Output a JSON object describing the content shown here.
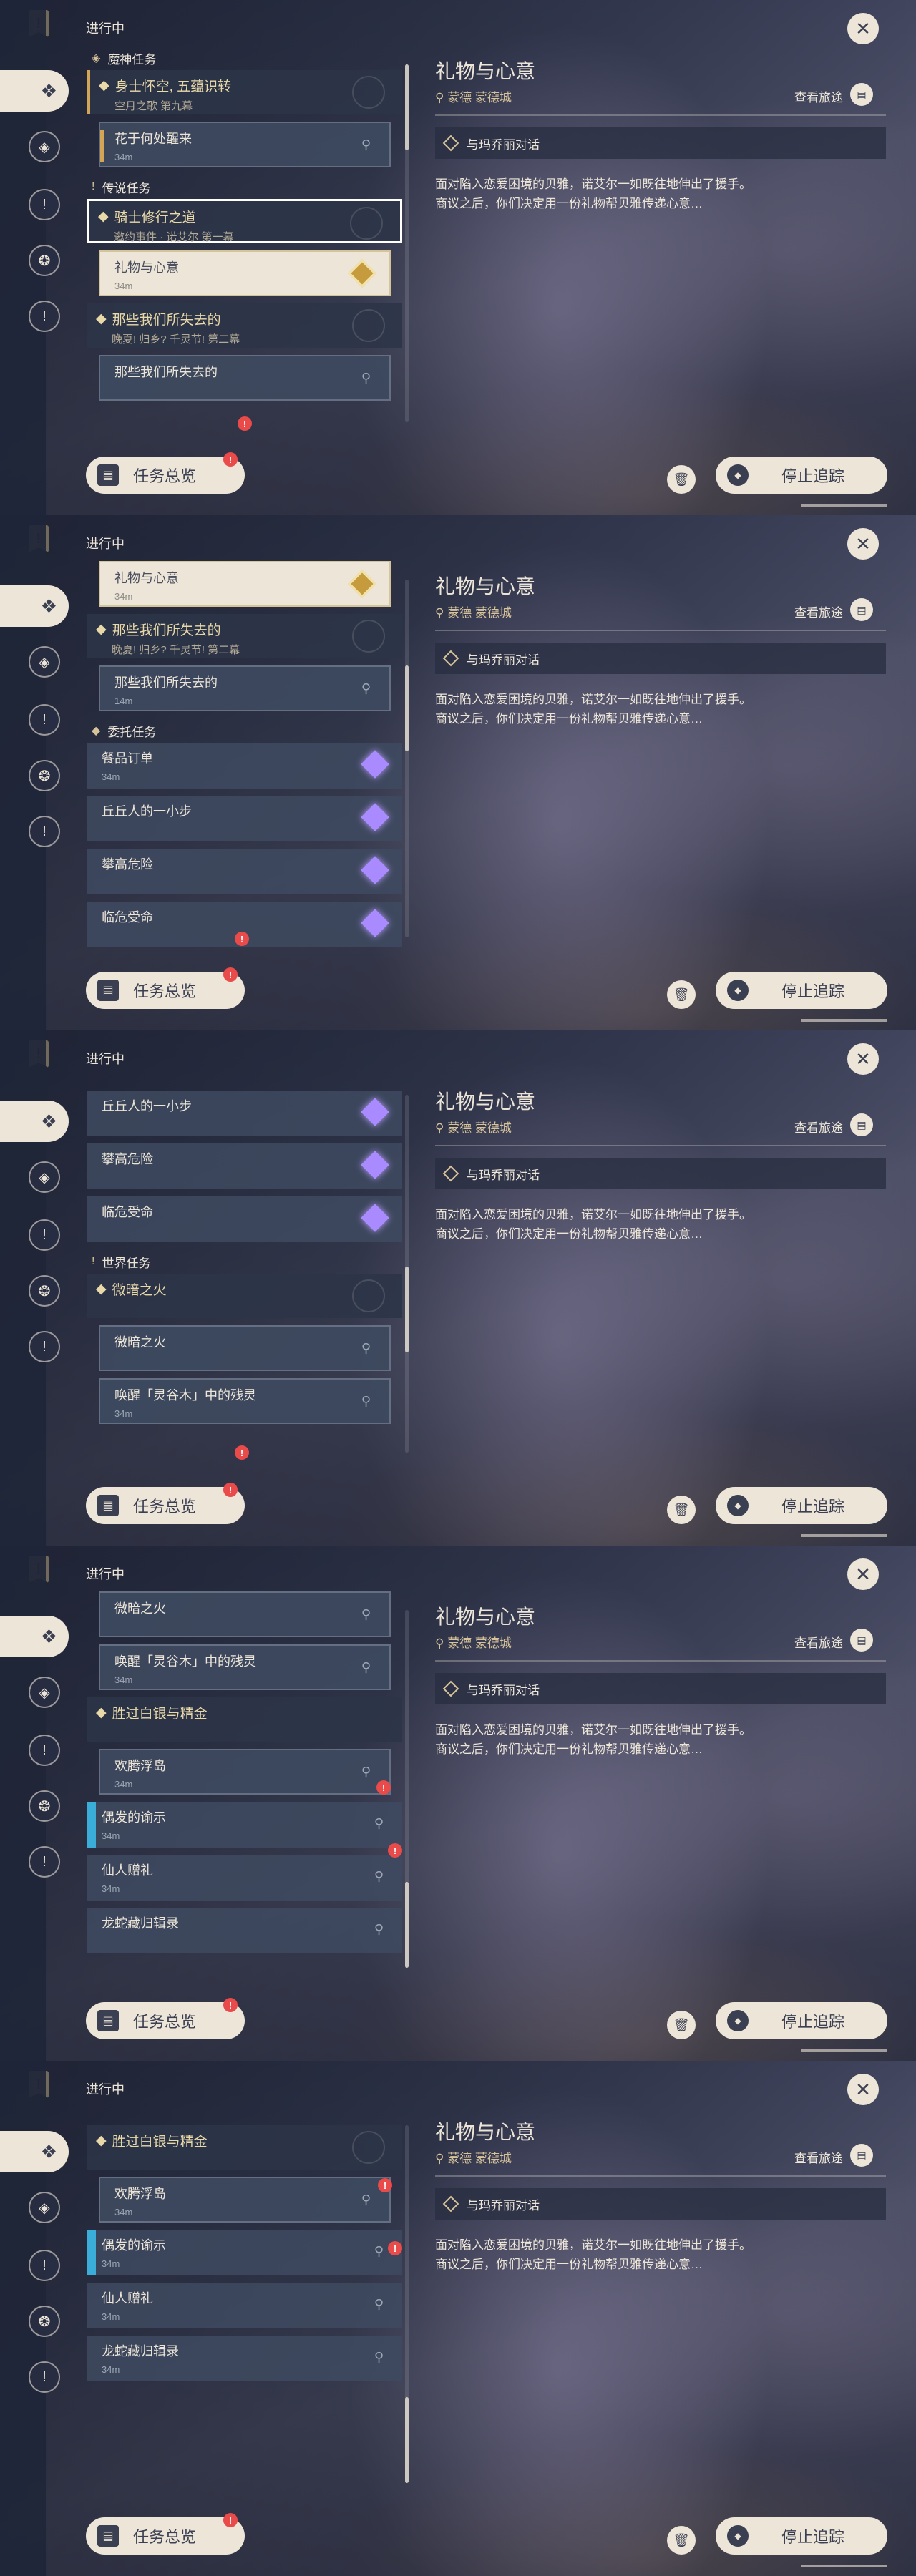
{
  "header": {
    "in_progress": "进行中"
  },
  "buttons": {
    "overview": "任务总览",
    "stop": "停止追踪",
    "alert": "!"
  },
  "categories": {
    "archon": "魔神任务",
    "legend": "传说任务",
    "commission": "委托任务",
    "world": "世界任务"
  },
  "detail": {
    "title": "礼物与心意",
    "location": "蒙德 蒙德城",
    "journey": "查看旅途",
    "objective": "与玛乔丽对话",
    "desc_line1": "面对陷入恋爱困境的贝雅，诺艾尔一如既往地伸出了援手。",
    "desc_line2": "商议之后，你们决定用一份礼物帮贝雅传递心意…"
  },
  "quests": {
    "archon_group": {
      "title": "身士怀空, 五蕴识转",
      "sub": "空月之歌 第九幕"
    },
    "archon_item": {
      "name": "花于何处醒来",
      "dist": "34m"
    },
    "legend_group": {
      "title": "骑士修行之道",
      "sub": "邀约事件 · 诺艾尔 第一幕"
    },
    "legend_item": {
      "name": "礼物与心意",
      "dist": "34m"
    },
    "lost_group": {
      "title": "那些我们所失去的",
      "sub": "晚夏! 归乡? 千灵节! 第二幕"
    },
    "lost_item": {
      "name": "那些我们所失去的",
      "dist": "14m"
    },
    "comm1": {
      "name": "餐品订单",
      "dist": "34m"
    },
    "comm2": {
      "name": "丘丘人的一小步"
    },
    "comm3": {
      "name": "攀高危险"
    },
    "comm4": {
      "name": "临危受命"
    },
    "world_group": {
      "title": "微暗之火"
    },
    "world_item1": {
      "name": "微暗之火"
    },
    "world_item2": {
      "name": "唤醒「灵谷木」中的残灵",
      "dist": "34m"
    },
    "silver_group": {
      "title": "胜过白银与精金"
    },
    "silver1": {
      "name": "欢腾浮岛",
      "dist": "34m"
    },
    "silver2": {
      "name": "偶发的谕示",
      "dist": "34m"
    },
    "silver3": {
      "name": "仙人赠礼",
      "dist": "34m"
    },
    "silver4": {
      "name": "龙蛇藏归辑录",
      "dist": "34m"
    }
  }
}
